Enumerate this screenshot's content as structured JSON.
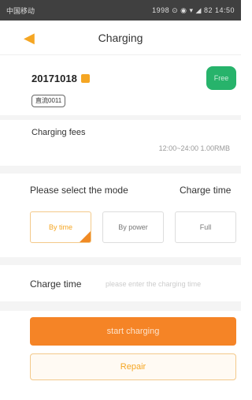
{
  "status_bar": {
    "left": "中国移动",
    "right": "1998 ⊙ ◉ ▾ ◢ 82 14:50"
  },
  "nav": {
    "back_icon": "◀",
    "title": "Charging"
  },
  "station": {
    "id": "20171018",
    "status": "Free",
    "tag": "直流0011"
  },
  "fees": {
    "label": "Charging fees",
    "value": "12:00~24:00 1.00RMB"
  },
  "mode": {
    "label": "Please select the mode",
    "charge_time_label": "Charge time"
  },
  "modes": [
    {
      "label": "By time",
      "selected": true
    },
    {
      "label": "By power",
      "selected": false
    },
    {
      "label": "Full",
      "selected": false
    }
  ],
  "charge_time": {
    "label": "Charge time",
    "placeholder": "please enter the charging time"
  },
  "actions": {
    "start_label": "start charging",
    "repair_label": "Repair"
  },
  "colors": {
    "accent": "#f58426",
    "free": "#27b36b"
  }
}
